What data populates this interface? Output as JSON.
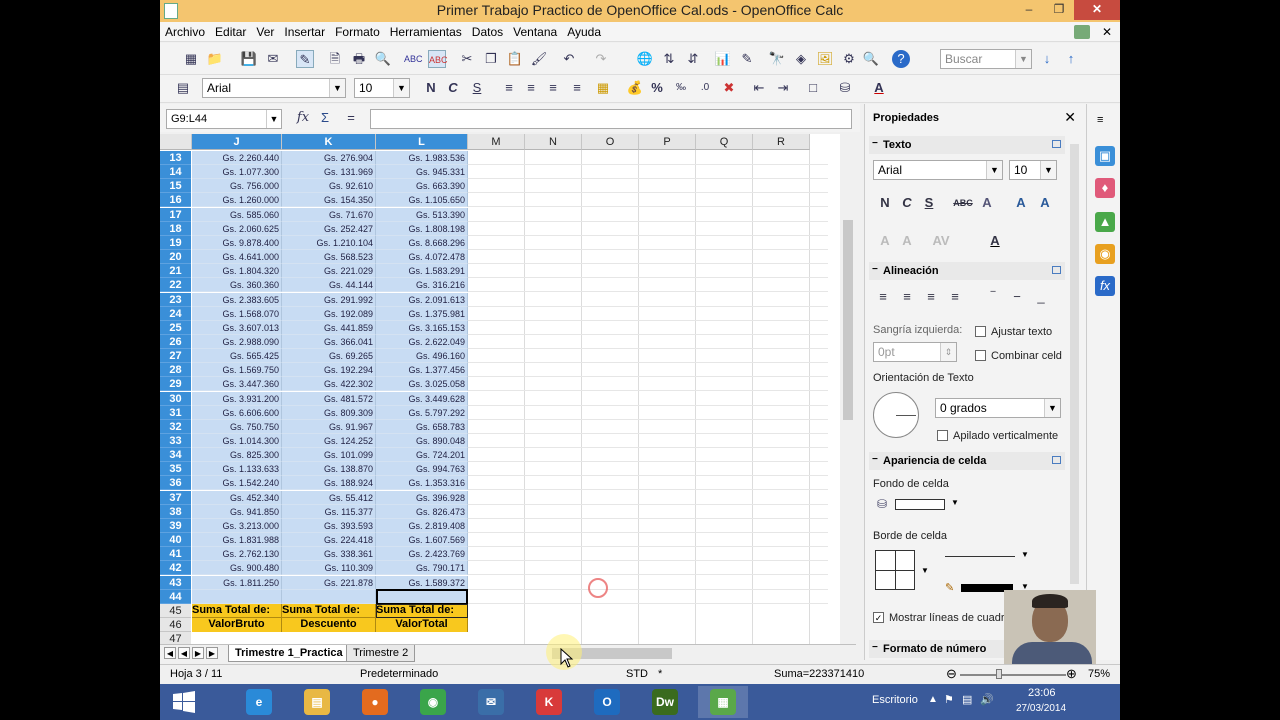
{
  "window": {
    "title": "Primer Trabajo Practico de OpenOffice Cal.ods - OpenOffice Calc",
    "minimize": "–",
    "maximize": "❐",
    "close": "✕"
  },
  "menu": {
    "items": [
      "Archivo",
      "Editar",
      "Ver",
      "Insertar",
      "Formato",
      "Herramientas",
      "Datos",
      "Ventana",
      "Ayuda"
    ],
    "close": "✕"
  },
  "toolbar": {
    "search_placeholder": "Buscar",
    "font_name": "Arial",
    "font_size": "10",
    "bold": "N",
    "italic": "C",
    "underline": "S",
    "percent": "%"
  },
  "formula_bar": {
    "name_box": "G9:L44",
    "fx": "fx",
    "sum": "Σ",
    "equals": "="
  },
  "sheet": {
    "columns": [
      {
        "label": "J",
        "selected": true
      },
      {
        "label": "K",
        "selected": true
      },
      {
        "label": "L",
        "selected": true
      },
      {
        "label": "M",
        "selected": false
      },
      {
        "label": "N",
        "selected": false
      },
      {
        "label": "O",
        "selected": false
      },
      {
        "label": "P",
        "selected": false
      },
      {
        "label": "Q",
        "selected": false
      },
      {
        "label": "R",
        "selected": false
      }
    ],
    "rows": [
      {
        "n": "13",
        "j": "Gs. 2.260.440",
        "k": "Gs. 276.904",
        "l": "Gs. 1.983.536"
      },
      {
        "n": "14",
        "j": "Gs. 1.077.300",
        "k": "Gs. 131.969",
        "l": "Gs. 945.331"
      },
      {
        "n": "15",
        "j": "Gs. 756.000",
        "k": "Gs. 92.610",
        "l": "Gs. 663.390"
      },
      {
        "n": "16",
        "j": "Gs. 1.260.000",
        "k": "Gs. 154.350",
        "l": "Gs. 1.105.650"
      },
      {
        "n": "17",
        "j": "Gs. 585.060",
        "k": "Gs. 71.670",
        "l": "Gs. 513.390"
      },
      {
        "n": "18",
        "j": "Gs. 2.060.625",
        "k": "Gs. 252.427",
        "l": "Gs. 1.808.198"
      },
      {
        "n": "19",
        "j": "Gs. 9.878.400",
        "k": "Gs. 1.210.104",
        "l": "Gs. 8.668.296"
      },
      {
        "n": "20",
        "j": "Gs. 4.641.000",
        "k": "Gs. 568.523",
        "l": "Gs. 4.072.478"
      },
      {
        "n": "21",
        "j": "Gs. 1.804.320",
        "k": "Gs. 221.029",
        "l": "Gs. 1.583.291"
      },
      {
        "n": "22",
        "j": "Gs. 360.360",
        "k": "Gs. 44.144",
        "l": "Gs. 316.216"
      },
      {
        "n": "23",
        "j": "Gs. 2.383.605",
        "k": "Gs. 291.992",
        "l": "Gs. 2.091.613"
      },
      {
        "n": "24",
        "j": "Gs. 1.568.070",
        "k": "Gs. 192.089",
        "l": "Gs. 1.375.981"
      },
      {
        "n": "25",
        "j": "Gs. 3.607.013",
        "k": "Gs. 441.859",
        "l": "Gs. 3.165.153"
      },
      {
        "n": "26",
        "j": "Gs. 2.988.090",
        "k": "Gs. 366.041",
        "l": "Gs. 2.622.049"
      },
      {
        "n": "27",
        "j": "Gs. 565.425",
        "k": "Gs. 69.265",
        "l": "Gs. 496.160"
      },
      {
        "n": "28",
        "j": "Gs. 1.569.750",
        "k": "Gs. 192.294",
        "l": "Gs. 1.377.456"
      },
      {
        "n": "29",
        "j": "Gs. 3.447.360",
        "k": "Gs. 422.302",
        "l": "Gs. 3.025.058"
      },
      {
        "n": "30",
        "j": "Gs. 3.931.200",
        "k": "Gs. 481.572",
        "l": "Gs. 3.449.628"
      },
      {
        "n": "31",
        "j": "Gs. 6.606.600",
        "k": "Gs. 809.309",
        "l": "Gs. 5.797.292"
      },
      {
        "n": "32",
        "j": "Gs. 750.750",
        "k": "Gs. 91.967",
        "l": "Gs. 658.783"
      },
      {
        "n": "33",
        "j": "Gs. 1.014.300",
        "k": "Gs. 124.252",
        "l": "Gs. 890.048"
      },
      {
        "n": "34",
        "j": "Gs. 825.300",
        "k": "Gs. 101.099",
        "l": "Gs. 724.201"
      },
      {
        "n": "35",
        "j": "Gs. 1.133.633",
        "k": "Gs. 138.870",
        "l": "Gs. 994.763"
      },
      {
        "n": "36",
        "j": "Gs. 1.542.240",
        "k": "Gs. 188.924",
        "l": "Gs. 1.353.316"
      },
      {
        "n": "37",
        "j": "Gs. 452.340",
        "k": "Gs. 55.412",
        "l": "Gs. 396.928"
      },
      {
        "n": "38",
        "j": "Gs. 941.850",
        "k": "Gs. 115.377",
        "l": "Gs. 826.473"
      },
      {
        "n": "39",
        "j": "Gs. 3.213.000",
        "k": "Gs. 393.593",
        "l": "Gs. 2.819.408"
      },
      {
        "n": "40",
        "j": "Gs. 1.831.988",
        "k": "Gs. 224.418",
        "l": "Gs. 1.607.569"
      },
      {
        "n": "41",
        "j": "Gs. 2.762.130",
        "k": "Gs. 338.361",
        "l": "Gs. 2.423.769"
      },
      {
        "n": "42",
        "j": "Gs. 900.480",
        "k": "Gs. 110.309",
        "l": "Gs. 790.171"
      },
      {
        "n": "43",
        "j": "Gs. 1.811.250",
        "k": "Gs. 221.878",
        "l": "Gs. 1.589.372"
      },
      {
        "n": "44",
        "j": "",
        "k": "",
        "l": ""
      }
    ],
    "row45": {
      "n": "45",
      "j": "Suma Total de:",
      "k": "Suma Total de:",
      "l": "Suma Total de:"
    },
    "row46": {
      "n": "46",
      "j": "ValorBruto",
      "k": "Descuento",
      "l": "ValorTotal"
    },
    "row47": {
      "n": "47"
    }
  },
  "tabs": {
    "active": "Trimestre 1_Practica",
    "second": "Trimestre 2"
  },
  "status": {
    "sheet": "Hoja 3 / 11",
    "style": "Predeterminado",
    "mode": "STD",
    "modified": "*",
    "sum": "Suma=223371410",
    "zoom": "75%",
    "zoom_minus": "⊖",
    "zoom_plus": "⊕"
  },
  "sidebar": {
    "title": "Propiedades",
    "close": "✕",
    "texto": {
      "header": "Texto",
      "font": "Arial",
      "size": "10",
      "bold": "N",
      "italic": "C",
      "underline": "S"
    },
    "alineacion": {
      "header": "Alineación",
      "sangria_label": "Sangría izquierda:",
      "sangria_value": "0pt",
      "ajustar": "Ajustar texto",
      "combinar": "Combinar celd",
      "orientacion": "Orientación de Texto",
      "grados": "0 grados",
      "apilado": "Apilado verticalmente"
    },
    "apariencia": {
      "header": "Apariencia de celda",
      "fondo": "Fondo de celda",
      "borde": "Borde de celda",
      "lineas": "Mostrar líneas de cuadr"
    },
    "formato": {
      "header": "Formato de número"
    }
  },
  "taskbar": {
    "tray_label": "Escritorio",
    "time": "23:06",
    "date": "27/03/2014",
    "apps": [
      {
        "name": "ie",
        "glyph": "e",
        "color": "#2a8ad8"
      },
      {
        "name": "explorer",
        "glyph": "▤",
        "color": "#e8b844"
      },
      {
        "name": "firefox",
        "glyph": "●",
        "color": "#e36b1f"
      },
      {
        "name": "chrome",
        "glyph": "◉",
        "color": "#3aa54a"
      },
      {
        "name": "thunderbird",
        "glyph": "✉",
        "color": "#3a6ea8"
      },
      {
        "name": "kaspersky",
        "glyph": "K",
        "color": "#d83a3a"
      },
      {
        "name": "outlook",
        "glyph": "O",
        "color": "#1e6bbf"
      },
      {
        "name": "dreamweaver",
        "glyph": "Dw",
        "color": "#3a6b1e"
      },
      {
        "name": "calc",
        "glyph": "▦",
        "color": "#5aa84a"
      }
    ]
  },
  "colors": {
    "title_bar": "#f4c56f",
    "selection": "#c8dcf3",
    "header_selected": "#3a8fd8",
    "total_yellow": "#f8c81e",
    "taskbar": "#3a5a9a"
  }
}
